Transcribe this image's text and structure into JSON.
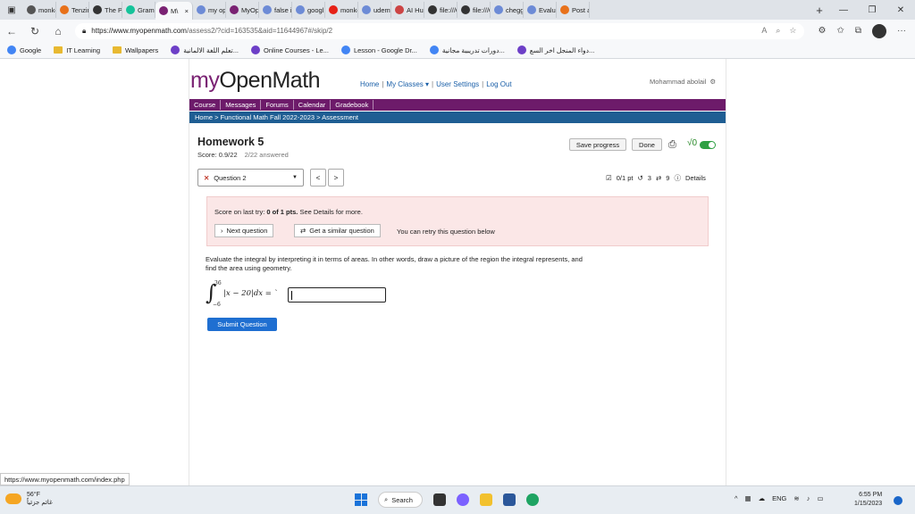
{
  "browser": {
    "tabs": [
      {
        "label": "monke",
        "icon_color": "#555555",
        "active": false
      },
      {
        "label": "Tenzin",
        "icon_color": "#e8711a",
        "active": false
      },
      {
        "label": "The Pe",
        "icon_color": "#333333",
        "active": false
      },
      {
        "label": "Gramr",
        "icon_color": "#15c39a",
        "active": false
      },
      {
        "label": "M\\",
        "icon_color": "#7a2273",
        "active": true,
        "close": "×"
      },
      {
        "label": "my op",
        "icon_color": "#6d8bd6",
        "active": false
      },
      {
        "label": "MyOp",
        "icon_color": "#7a2273",
        "active": false
      },
      {
        "label": "false in",
        "icon_color": "#6d8bd6",
        "active": false
      },
      {
        "label": "googl",
        "icon_color": "#6d8bd6",
        "active": false
      },
      {
        "label": "monke",
        "icon_color": "#e62117",
        "active": false
      },
      {
        "label": "udemy",
        "icon_color": "#6d8bd6",
        "active": false
      },
      {
        "label": "AI Hus",
        "icon_color": "#cc4444",
        "active": false
      },
      {
        "label": "file:///C",
        "icon_color": "#333333",
        "active": false
      },
      {
        "label": "file:///C",
        "icon_color": "#333333",
        "active": false
      },
      {
        "label": "chegg",
        "icon_color": "#6d8bd6",
        "active": false
      },
      {
        "label": "Evaluat",
        "icon_color": "#6d8bd6",
        "active": false
      },
      {
        "label": "Post a",
        "icon_color": "#e8711a",
        "active": false
      }
    ],
    "new_tab": "+",
    "window_controls": {
      "minimize": "—",
      "restore": "❐",
      "close": "✕"
    },
    "url_host": "https://www.myopenmath.com",
    "url_path": "/assess2/?cid=163535&aid=11644967#/skip/2",
    "bookmarks": [
      {
        "label": "Google",
        "kind": "google"
      },
      {
        "label": "IT Learning",
        "kind": "folder"
      },
      {
        "label": "Wallpapers",
        "kind": "folder"
      },
      {
        "label": "تعلم اللغة الالمانية...",
        "kind": "site"
      },
      {
        "label": "Online Courses - Le...",
        "kind": "site"
      },
      {
        "label": "Lesson - Google Dr...",
        "kind": "google"
      },
      {
        "label": "دورات تدريبية مجانية...",
        "kind": "google"
      },
      {
        "label": "دواء المنجل اخر السع...",
        "kind": "site"
      }
    ]
  },
  "site": {
    "logo_my": "my",
    "logo_rest": "OpenMath",
    "top_links": {
      "home": "Home",
      "my_classes": "My Classes ▾",
      "user_settings": "User Settings",
      "logout": "Log Out"
    },
    "user_name": "Mohammad abolail",
    "menu": [
      "Course",
      "Messages",
      "Forums",
      "Calendar",
      "Gradebook"
    ],
    "breadcrumb": "Home > Functional Math Fall 2022-2023 > Assessment"
  },
  "assessment": {
    "title": "Homework 5",
    "score": "Score: 0.9/22",
    "answered": "2/22 answered",
    "save_progress": "Save progress",
    "done": "Done",
    "question_select": "Question 2",
    "prev": "<",
    "next": ">",
    "points": "0/1 pt",
    "retries": "3",
    "attempts": "9",
    "details": "Details",
    "notice_prefix": "Score on last try: ",
    "notice_score": "0 of 1 pts.",
    "notice_suffix": " See Details for more.",
    "next_question": "Next question",
    "similar_question": "Get a similar question",
    "retry_text": "You can retry this question below",
    "question_text": "Evaluate the integral by interpreting it in terms of areas. In other words, draw a picture of the region the integral represents, and find the area using geometry.",
    "integral_upper": "36",
    "integral_lower": "−6",
    "integrand": "|x − 20|dx = `",
    "answer_value": "",
    "submit": "Submit Question"
  },
  "status_url": "https://www.myopenmath.com/index.php",
  "taskbar": {
    "temp": "56°F",
    "weather": "غائم جزئياً",
    "search": "Search",
    "lang": "ENG",
    "time": "6:55 PM",
    "date": "1/15/2023"
  }
}
